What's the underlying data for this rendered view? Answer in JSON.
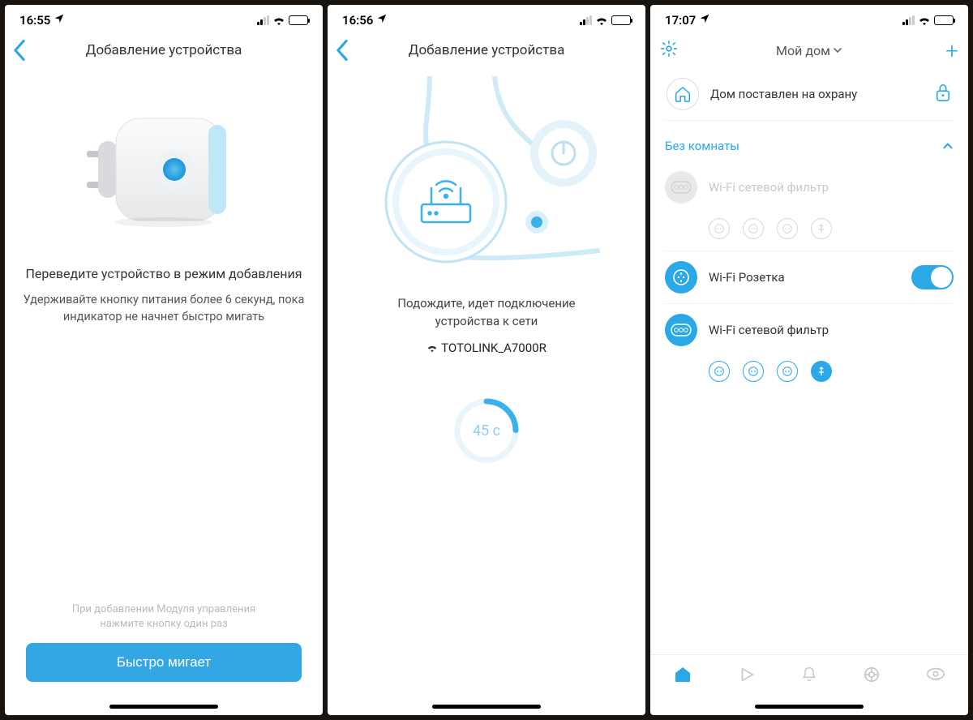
{
  "screen1": {
    "time": "16:55",
    "title": "Добавление устройства",
    "heading": "Переведите устройство в режим добавления",
    "sub": "Удерживайте кнопку питания более 6 секунд, пока индикатор не начнет быстро мигать",
    "footnote_l1": "При добавлении Модуля управления",
    "footnote_l2": "нажмите кнопку один раз",
    "button": "Быстро мигает"
  },
  "screen2": {
    "time": "16:56",
    "title": "Добавление устройства",
    "wait_l1": "Подождите, идет подключение",
    "wait_l2": "устройства к сети",
    "network": "TOTOLINK_A7000R",
    "countdown": "45 с",
    "progress_pct": 25
  },
  "screen3": {
    "time": "17:07",
    "home_title": "Мой дом",
    "armed_text": "Дом поставлен на охрану",
    "section": "Без комнаты",
    "dev1": "Wi-Fi сетевой фильтр",
    "dev2": "Wi-Fi Розетка",
    "dev3": "Wi-Fi сетевой фильтр",
    "dev2_on": true
  }
}
